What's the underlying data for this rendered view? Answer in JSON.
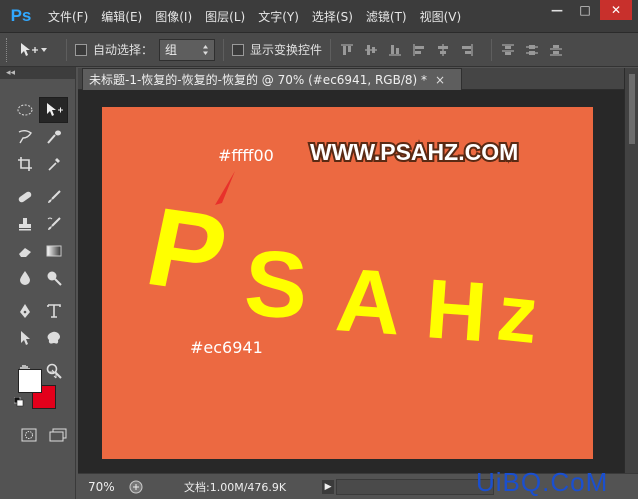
{
  "app": {
    "logo": "Ps",
    "menu": [
      "文件(F)",
      "编辑(E)",
      "图像(I)",
      "图层(L)",
      "文字(Y)",
      "选择(S)",
      "滤镜(T)",
      "视图(V)"
    ],
    "window_controls": {
      "minimize": "—",
      "maximize": "□",
      "close": "✕"
    }
  },
  "options_bar": {
    "auto_select_label": "自动选择：",
    "auto_select_value": "组",
    "show_transform_label": "显示变换控件"
  },
  "document": {
    "tab_title": "未标题-1-恢复的-恢复的-恢复的 @ 70% (#ec6941, RGB/8) *",
    "tab_close": "×",
    "canvas": {
      "background_color": "#ec6941",
      "logo_text": "WWW.PSAHZ.COM",
      "yellow_letters": [
        "P",
        "S",
        "A",
        "H",
        "z"
      ],
      "yellow_color": "#ffff00",
      "annotation_yellow": "#ffff00",
      "annotation_orange": "#ec6941"
    }
  },
  "tools": {
    "foreground_color": "#ffffff",
    "background_color": "#e3001b",
    "collapse_arrows": "◂◂"
  },
  "status": {
    "zoom": "70%",
    "doc_info": "文档:1.00M/476.9K",
    "arrow": "▶"
  },
  "watermark": "UiBQ.CoM"
}
